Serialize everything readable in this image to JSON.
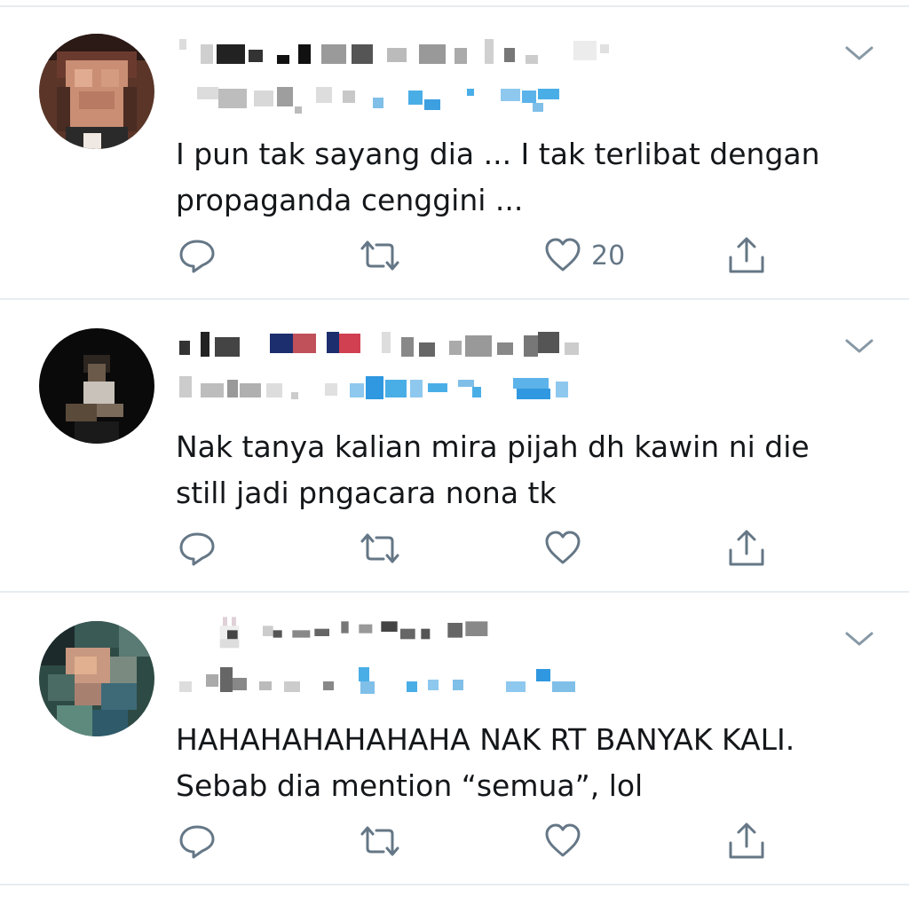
{
  "tweets": [
    {
      "text": "I pun tak sayang dia ... I tak terlibat dengan\npropaganda cenggini ...",
      "like_count": "20",
      "avatar_icon": "blurred-avatar",
      "menu_icon": "chevron-down-icon"
    },
    {
      "text": "Nak tanya kalian mira pijah dh kawin ni die\nstill jadi pngacara nona tk",
      "like_count": "",
      "avatar_icon": "blurred-avatar",
      "menu_icon": "chevron-down-icon"
    },
    {
      "text": "HAHAHAHAHAHAHA NAK RT BANYAK KALI.\nSebab dia mention “semua”, lol",
      "like_count": "",
      "avatar_icon": "blurred-avatar",
      "menu_icon": "chevron-down-icon"
    }
  ],
  "icons": {
    "reply": "reply-icon",
    "retweet": "retweet-icon",
    "like": "heart-icon",
    "share": "share-icon"
  },
  "colors": {
    "text": "#14171a",
    "icon": "#657786",
    "link_blue": "#1da1f2",
    "divider": "#e6ecf0"
  }
}
